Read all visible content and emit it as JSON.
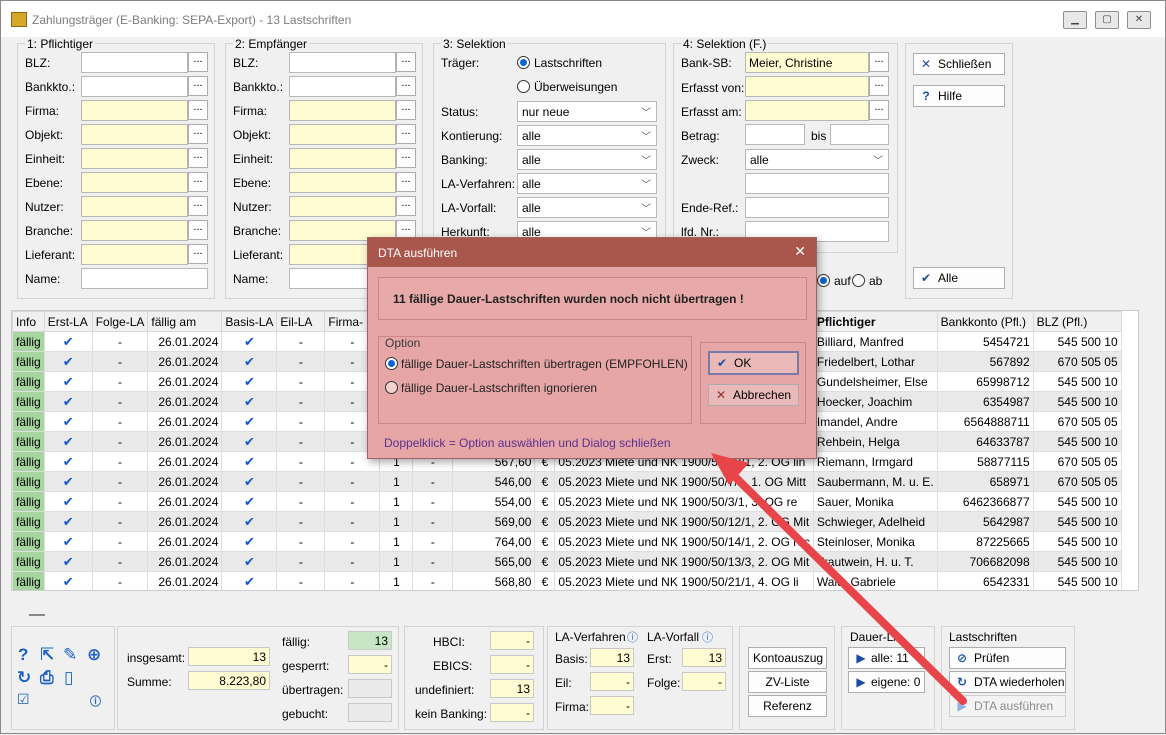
{
  "window": {
    "title": "Zahlungsträger (E-Banking: SEPA-Export) - 13 Lastschriften"
  },
  "panel1": {
    "title": "1: Pflichtiger",
    "labels": [
      "BLZ:",
      "Bankkto.:",
      "Firma:",
      "Objekt:",
      "Einheit:",
      "Ebene:",
      "Nutzer:",
      "Branche:",
      "Lieferant:",
      "Name:"
    ]
  },
  "panel2": {
    "title": "2: Empfänger",
    "labels": [
      "BLZ:",
      "Bankkto.:",
      "Firma:",
      "Objekt:",
      "Einheit:",
      "Ebene:",
      "Nutzer:",
      "Branche:",
      "Lieferant:",
      "Name:"
    ]
  },
  "panel3": {
    "title": "3: Selektion",
    "traeger_label": "Träger:",
    "radio_last": "Lastschriften",
    "radio_ueber": "Überweisungen",
    "rows": [
      {
        "label": "Status:",
        "value": "nur neue"
      },
      {
        "label": "Kontierung:",
        "value": "alle"
      },
      {
        "label": "Banking:",
        "value": "alle"
      },
      {
        "label": "LA-Verfahren:",
        "value": "alle"
      },
      {
        "label": "LA-Vorfall:",
        "value": "alle"
      },
      {
        "label": "Herkunft:",
        "value": "alle"
      }
    ]
  },
  "panel4": {
    "title": "4: Selektion (F.)",
    "bank_sb_label": "Bank-SB:",
    "bank_sb_value": "Meier, Christine",
    "erfasst_von": "Erfasst von:",
    "erfasst_am": "Erfasst am:",
    "betrag": "Betrag:",
    "bis": "bis",
    "zweck": "Zweck:",
    "zweck_value": "alle",
    "ende_ref": "Ende-Ref.:",
    "lfd_nr": "lfd. Nr.:",
    "auf": "auf",
    "ab": "ab"
  },
  "buttons": {
    "schliessen": "Schließen",
    "hilfe": "Hilfe",
    "alle": "Alle"
  },
  "grid": {
    "columns": [
      "Info",
      "Erst-LA",
      "Folge-LA",
      "fällig am",
      "Basis-LA",
      "Eil-LA",
      "Firma-",
      "",
      "",
      "",
      "",
      "",
      "Pflichtiger",
      "Bankkonto (Pfl.)",
      "BLZ (Pfl.)"
    ],
    "rows": [
      {
        "info": "fällig",
        "date": "26.01.2024",
        "folge": "-",
        "eil": "-",
        "firma": "-",
        "n": "1",
        "d": "-",
        "amount": "",
        "cur": "",
        "zweck": "",
        "pfl": "Billiard, Manfred",
        "konto": "5454721",
        "blz": "545 500 10"
      },
      {
        "info": "fällig",
        "date": "26.01.2024",
        "folge": "-",
        "eil": "-",
        "firma": "-",
        "n": "1",
        "d": "-",
        "amount": "",
        "cur": "",
        "zweck": "",
        "pfl": "Friedelbert, Lothar",
        "konto": "567892",
        "blz": "670 505 05"
      },
      {
        "info": "fällig",
        "date": "26.01.2024",
        "folge": "-",
        "eil": "-",
        "firma": "-",
        "n": "1",
        "d": "-",
        "amount": "",
        "cur": "",
        "zweck": "",
        "pfl": "Gundelsheimer, Else",
        "konto": "65998712",
        "blz": "545 500 10"
      },
      {
        "info": "fällig",
        "date": "26.01.2024",
        "folge": "-",
        "eil": "-",
        "firma": "-",
        "n": "1",
        "d": "-",
        "amount": "",
        "cur": "",
        "zweck": "",
        "pfl": "Hoecker, Joachim",
        "konto": "6354987",
        "blz": "545 500 10"
      },
      {
        "info": "fällig",
        "date": "26.01.2024",
        "folge": "-",
        "eil": "-",
        "firma": "-",
        "n": "1",
        "d": "-",
        "amount": "",
        "cur": "",
        "zweck": "",
        "pfl": "Imandel, Andre",
        "konto": "6564888711",
        "blz": "670 505 05"
      },
      {
        "info": "fällig",
        "date": "26.01.2024",
        "folge": "-",
        "eil": "-",
        "firma": "-",
        "n": "1",
        "d": "-",
        "amount": "",
        "cur": "",
        "zweck": "",
        "pfl": "Rehbein, Helga",
        "konto": "64633787",
        "blz": "545 500 10"
      },
      {
        "info": "fällig",
        "date": "26.01.2024",
        "folge": "-",
        "eil": "-",
        "firma": "-",
        "n": "1",
        "d": "-",
        "amount": "567,60",
        "cur": "€",
        "zweck": "05.2023 Miete und NK 1900/50/10/1, 2. OG lin",
        "pfl": "Riemann, Irmgard",
        "konto": "58877115",
        "blz": "670 505 05"
      },
      {
        "info": "fällig",
        "date": "26.01.2024",
        "folge": "-",
        "eil": "-",
        "firma": "-",
        "n": "1",
        "d": "-",
        "amount": "546,00",
        "cur": "€",
        "zweck": "05.2023 Miete und NK 1900/50/7/1, 1. OG Mitt",
        "pfl": "Saubermann, M. u. E.",
        "konto": "658971",
        "blz": "670 505 05"
      },
      {
        "info": "fällig",
        "date": "26.01.2024",
        "folge": "-",
        "eil": "-",
        "firma": "-",
        "n": "1",
        "d": "-",
        "amount": "554,00",
        "cur": "€",
        "zweck": "05.2023 Miete und NK 1900/50/3/1, 3. OG re",
        "pfl": "Sauer, Monika",
        "konto": "6462366877",
        "blz": "545 500 10"
      },
      {
        "info": "fällig",
        "date": "26.01.2024",
        "folge": "-",
        "eil": "-",
        "firma": "-",
        "n": "1",
        "d": "-",
        "amount": "569,00",
        "cur": "€",
        "zweck": "05.2023 Miete und NK 1900/50/12/1, 2. OG Mit",
        "pfl": "Schwieger, Adelheid",
        "konto": "5642987",
        "blz": "545 500 10"
      },
      {
        "info": "fällig",
        "date": "26.01.2024",
        "folge": "-",
        "eil": "-",
        "firma": "-",
        "n": "1",
        "d": "-",
        "amount": "764,00",
        "cur": "€",
        "zweck": "05.2023 Miete und NK 1900/50/14/1, 2. OG rec",
        "pfl": "Steinloser, Monika",
        "konto": "87225665",
        "blz": "545 500 10"
      },
      {
        "info": "fällig",
        "date": "26.01.2024",
        "folge": "-",
        "eil": "-",
        "firma": "-",
        "n": "1",
        "d": "-",
        "amount": "565,00",
        "cur": "€",
        "zweck": "05.2023 Miete und NK 1900/50/13/3, 2. OG Mit",
        "pfl": "Trautwein, H. u. T.",
        "konto": "706682098",
        "blz": "545 500 10"
      },
      {
        "info": "fällig",
        "date": "26.01.2024",
        "folge": "-",
        "eil": "-",
        "firma": "-",
        "n": "1",
        "d": "-",
        "amount": "568,80",
        "cur": "€",
        "zweck": "05.2023 Miete und NK 1900/50/21/1, 4. OG li",
        "pfl": "Wald, Gabriele",
        "konto": "6542331",
        "blz": "545 500 10"
      }
    ]
  },
  "summary": {
    "insgesamt_label": "insgesamt:",
    "insgesamt": "13",
    "summe_label": "Summe:",
    "summe": "8.223,80",
    "faellig_label": "fällig:",
    "faellig": "13",
    "gesperrt_label": "gesperrt:",
    "gesperrt": "-",
    "uebertragen_label": "übertragen:",
    "uebertragen": "",
    "gebucht_label": "gebucht:",
    "gebucht": ""
  },
  "banking": {
    "hbci_label": "HBCI:",
    "hbci": "-",
    "ebics_label": "EBICS:",
    "ebics": "-",
    "undef_label": "undefiniert:",
    "undef": "13",
    "kein_label": "kein Banking:",
    "kein": "-"
  },
  "laverf": {
    "title": "LA-Verfahren",
    "basis_label": "Basis:",
    "basis": "13",
    "eil_label": "Eil:",
    "eil": "-",
    "firma_label": "Firma:",
    "firma": "-"
  },
  "lavorf": {
    "title": "LA-Vorfall",
    "erst_label": "Erst:",
    "erst": "13",
    "folge_label": "Folge:",
    "folge": "-"
  },
  "actions": {
    "kontoauszug": "Kontoauszug",
    "zvliste": "ZV-Liste",
    "referenz": "Referenz"
  },
  "dauer": {
    "title": "Dauer-LA",
    "alle": "alle: 11",
    "eigene": "eigene: 0"
  },
  "lastschriften": {
    "title": "Lastschriften",
    "pruefen": "Prüfen",
    "dta_wiederholen": "DTA wiederholen",
    "dta_ausfuehren": "DTA ausführen"
  },
  "dialog": {
    "title": "DTA ausführen",
    "message": "11 fällige Dauer-Lastschriften wurden noch nicht übertragen !",
    "option_title": "Option",
    "opt1": "fällige Dauer-Lastschriften übertragen (EMPFOHLEN)",
    "opt2": "fällige Dauer-Lastschriften ignorieren",
    "ok": "OK",
    "cancel": "Abbrechen",
    "hint": "Doppelklick = Option auswählen und Dialog schließen"
  },
  "colors": {
    "accent": "#1057c7",
    "dialog_bg": "#e6a6a6",
    "dialog_title": "#a9564c",
    "arrow": "#e8454a",
    "info_green": "#a7d59f",
    "yellow": "#fffbd2"
  }
}
